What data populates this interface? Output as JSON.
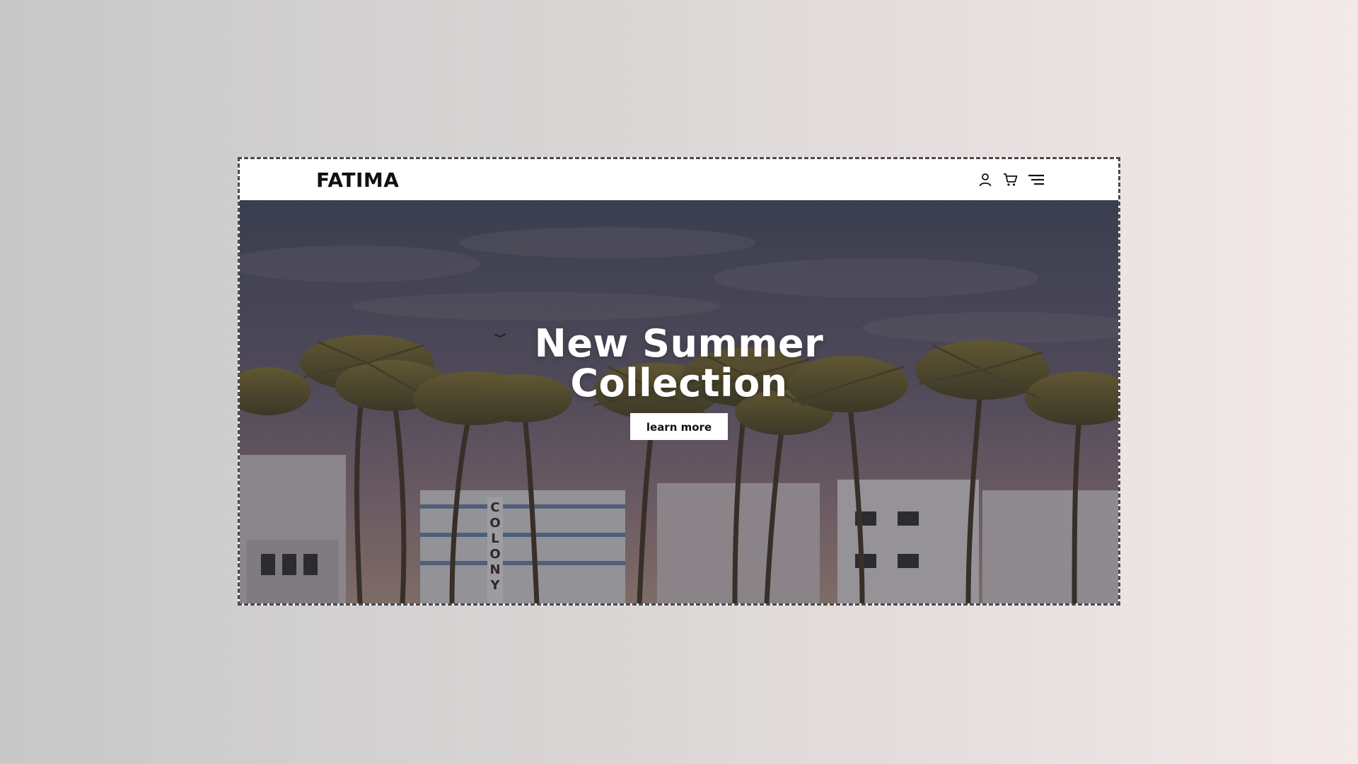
{
  "navbar": {
    "brand": "FATIMA",
    "icons": [
      "user-icon",
      "cart-icon",
      "menu-icon"
    ]
  },
  "hero": {
    "title_line1": "New Summer",
    "title_line2": "Collection",
    "button_label": "learn more",
    "building_sign": "COLONY"
  },
  "colors": {
    "background_left": "#c8c8c8",
    "background_right": "#f3e9e9",
    "navbar_bg": "#ffffff",
    "text_dark": "#111111",
    "hero_text": "#ffffff"
  }
}
